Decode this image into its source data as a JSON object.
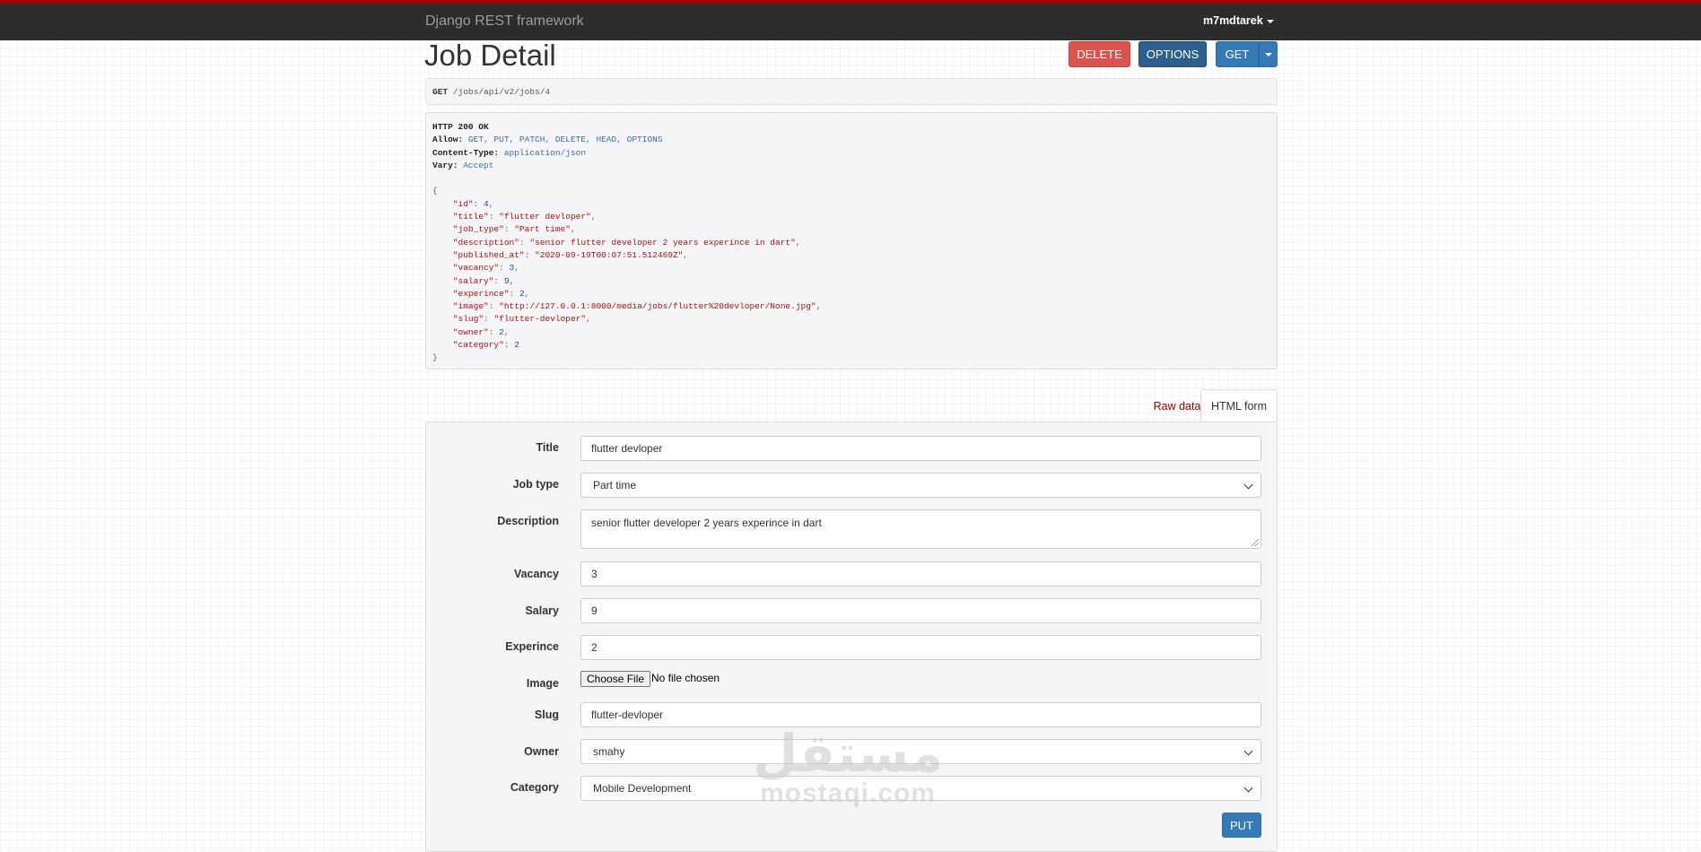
{
  "navbar": {
    "brand": "Django REST framework",
    "user": "m7mdtarek"
  },
  "page": {
    "title": "Job Detail"
  },
  "buttons": {
    "delete": "DELETE",
    "options": "OPTIONS",
    "get": "GET",
    "put": "PUT"
  },
  "request": {
    "method": "GET",
    "path": "/jobs/api/v2/jobs/4"
  },
  "response": {
    "status_line": "HTTP 200 OK",
    "headers": [
      {
        "key": "Allow:",
        "value": "GET, PUT, PATCH, DELETE, HEAD, OPTIONS"
      },
      {
        "key": "Content-Type:",
        "value": "application/json"
      },
      {
        "key": "Vary:",
        "value": "Accept"
      }
    ],
    "open_brace": "{",
    "close_brace": "}",
    "body": [
      {
        "key": "\"id\"",
        "value": "4",
        "type": "num",
        "comma": true
      },
      {
        "key": "\"title\"",
        "value": "\"flutter devloper\"",
        "type": "str",
        "comma": true
      },
      {
        "key": "\"job_type\"",
        "value": "\"Part time\"",
        "type": "str",
        "comma": true
      },
      {
        "key": "\"description\"",
        "value": "\"senior flutter developer 2 years experince in dart\"",
        "type": "str",
        "comma": true
      },
      {
        "key": "\"published_at\"",
        "value": "\"2020-09-19T00:07:51.512469Z\"",
        "type": "str",
        "comma": true
      },
      {
        "key": "\"vacancy\"",
        "value": "3",
        "type": "num",
        "comma": true
      },
      {
        "key": "\"salary\"",
        "value": "9",
        "type": "num",
        "comma": true
      },
      {
        "key": "\"experince\"",
        "value": "2",
        "type": "num",
        "comma": true
      },
      {
        "key": "\"image\"",
        "value": "\"http://127.0.0.1:8000/media/jobs/flutter%20devloper/None.jpg\"",
        "type": "str",
        "comma": true
      },
      {
        "key": "\"slug\"",
        "value": "\"flutter-devloper\"",
        "type": "str",
        "comma": true
      },
      {
        "key": "\"owner\"",
        "value": "2",
        "type": "num",
        "comma": true
      },
      {
        "key": "\"category\"",
        "value": "2",
        "type": "num",
        "comma": false
      }
    ]
  },
  "tabs": {
    "raw": "Raw data",
    "html": "HTML form"
  },
  "form": {
    "title": {
      "label": "Title",
      "value": "flutter devloper"
    },
    "job_type": {
      "label": "Job type",
      "value": "Part time"
    },
    "description": {
      "label": "Description",
      "value": "senior flutter developer 2 years experince in dart"
    },
    "vacancy": {
      "label": "Vacancy",
      "value": "3"
    },
    "salary": {
      "label": "Salary",
      "value": "9"
    },
    "experince": {
      "label": "Experince",
      "value": "2"
    },
    "image": {
      "label": "Image",
      "button": "Choose File",
      "status": "No file chosen"
    },
    "slug": {
      "label": "Slug",
      "value": "flutter-devloper"
    },
    "owner": {
      "label": "Owner",
      "value": "smahy"
    },
    "category": {
      "label": "Category",
      "value": "Mobile Development"
    }
  },
  "watermark": {
    "arabic": "مستقل",
    "latin": "mostaqi.com"
  },
  "colors": {
    "topbar": "#2c2c2c",
    "topbar_accent": "#a30000",
    "danger": "#d9534f",
    "primary": "#337ab7",
    "options": "#2c5f8e"
  }
}
